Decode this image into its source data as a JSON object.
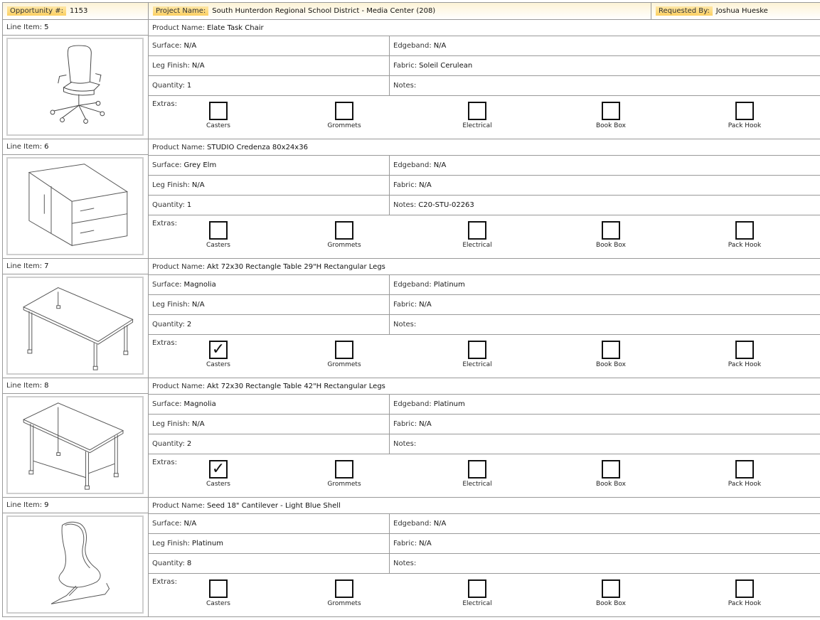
{
  "header": {
    "opportunity_label": "Opportunity #:",
    "opportunity_value": "1153",
    "project_label": "Project Name:",
    "project_value": "South Hunterdon Regional School District - Media Center (208)",
    "requested_label": "Requested By:",
    "requested_value": "Joshua Hueske"
  },
  "labels": {
    "line_item": "Line Item:",
    "product_name": "Product Name:",
    "surface": "Surface:",
    "edgeband": "Edgeband:",
    "leg_finish": "Leg Finish:",
    "fabric": "Fabric:",
    "quantity": "Quantity:",
    "notes": "Notes:",
    "extras": "Extras:",
    "casters": "Casters",
    "grommets": "Grommets",
    "electrical": "Electrical",
    "book_box": "Book Box",
    "pack_hook": "Pack Hook",
    "check_mark": "✓"
  },
  "items": [
    {
      "line": "5",
      "product": "Elate Task Chair",
      "surface": "N/A",
      "edgeband": "N/A",
      "leg_finish": "N/A",
      "fabric": "Soleil Cerulean",
      "quantity": "1",
      "notes": "",
      "image": "task-chair",
      "extras": {
        "casters": false,
        "grommets": false,
        "electrical": false,
        "book_box": false,
        "pack_hook": false
      }
    },
    {
      "line": "6",
      "product": "STUDIO Credenza 80x24x36",
      "surface": "Grey Elm",
      "edgeband": "N/A",
      "leg_finish": "N/A",
      "fabric": "N/A",
      "quantity": "1",
      "notes": "C20-STU-02263",
      "image": "credenza",
      "extras": {
        "casters": false,
        "grommets": false,
        "electrical": false,
        "book_box": false,
        "pack_hook": false
      }
    },
    {
      "line": "7",
      "product": "Akt 72x30 Rectangle Table 29\"H Rectangular Legs",
      "surface": "Magnolia",
      "edgeband": "Platinum",
      "leg_finish": "N/A",
      "fabric": "N/A",
      "quantity": "2",
      "notes": "",
      "image": "table-29",
      "extras": {
        "casters": true,
        "grommets": false,
        "electrical": false,
        "book_box": false,
        "pack_hook": false
      }
    },
    {
      "line": "8",
      "product": "Akt 72x30 Rectangle Table 42\"H Rectangular Legs",
      "surface": "Magnolia",
      "edgeband": "Platinum",
      "leg_finish": "N/A",
      "fabric": "N/A",
      "quantity": "2",
      "notes": "",
      "image": "table-42",
      "extras": {
        "casters": true,
        "grommets": false,
        "electrical": false,
        "book_box": false,
        "pack_hook": false
      }
    },
    {
      "line": "9",
      "product": "Seed 18\" Cantilever - Light Blue Shell",
      "surface": "N/A",
      "edgeband": "N/A",
      "leg_finish": "Platinum",
      "fabric": "N/A",
      "quantity": "8",
      "notes": "",
      "image": "cantilever-chair",
      "extras": {
        "casters": false,
        "grommets": false,
        "electrical": false,
        "book_box": false,
        "pack_hook": false
      }
    }
  ]
}
